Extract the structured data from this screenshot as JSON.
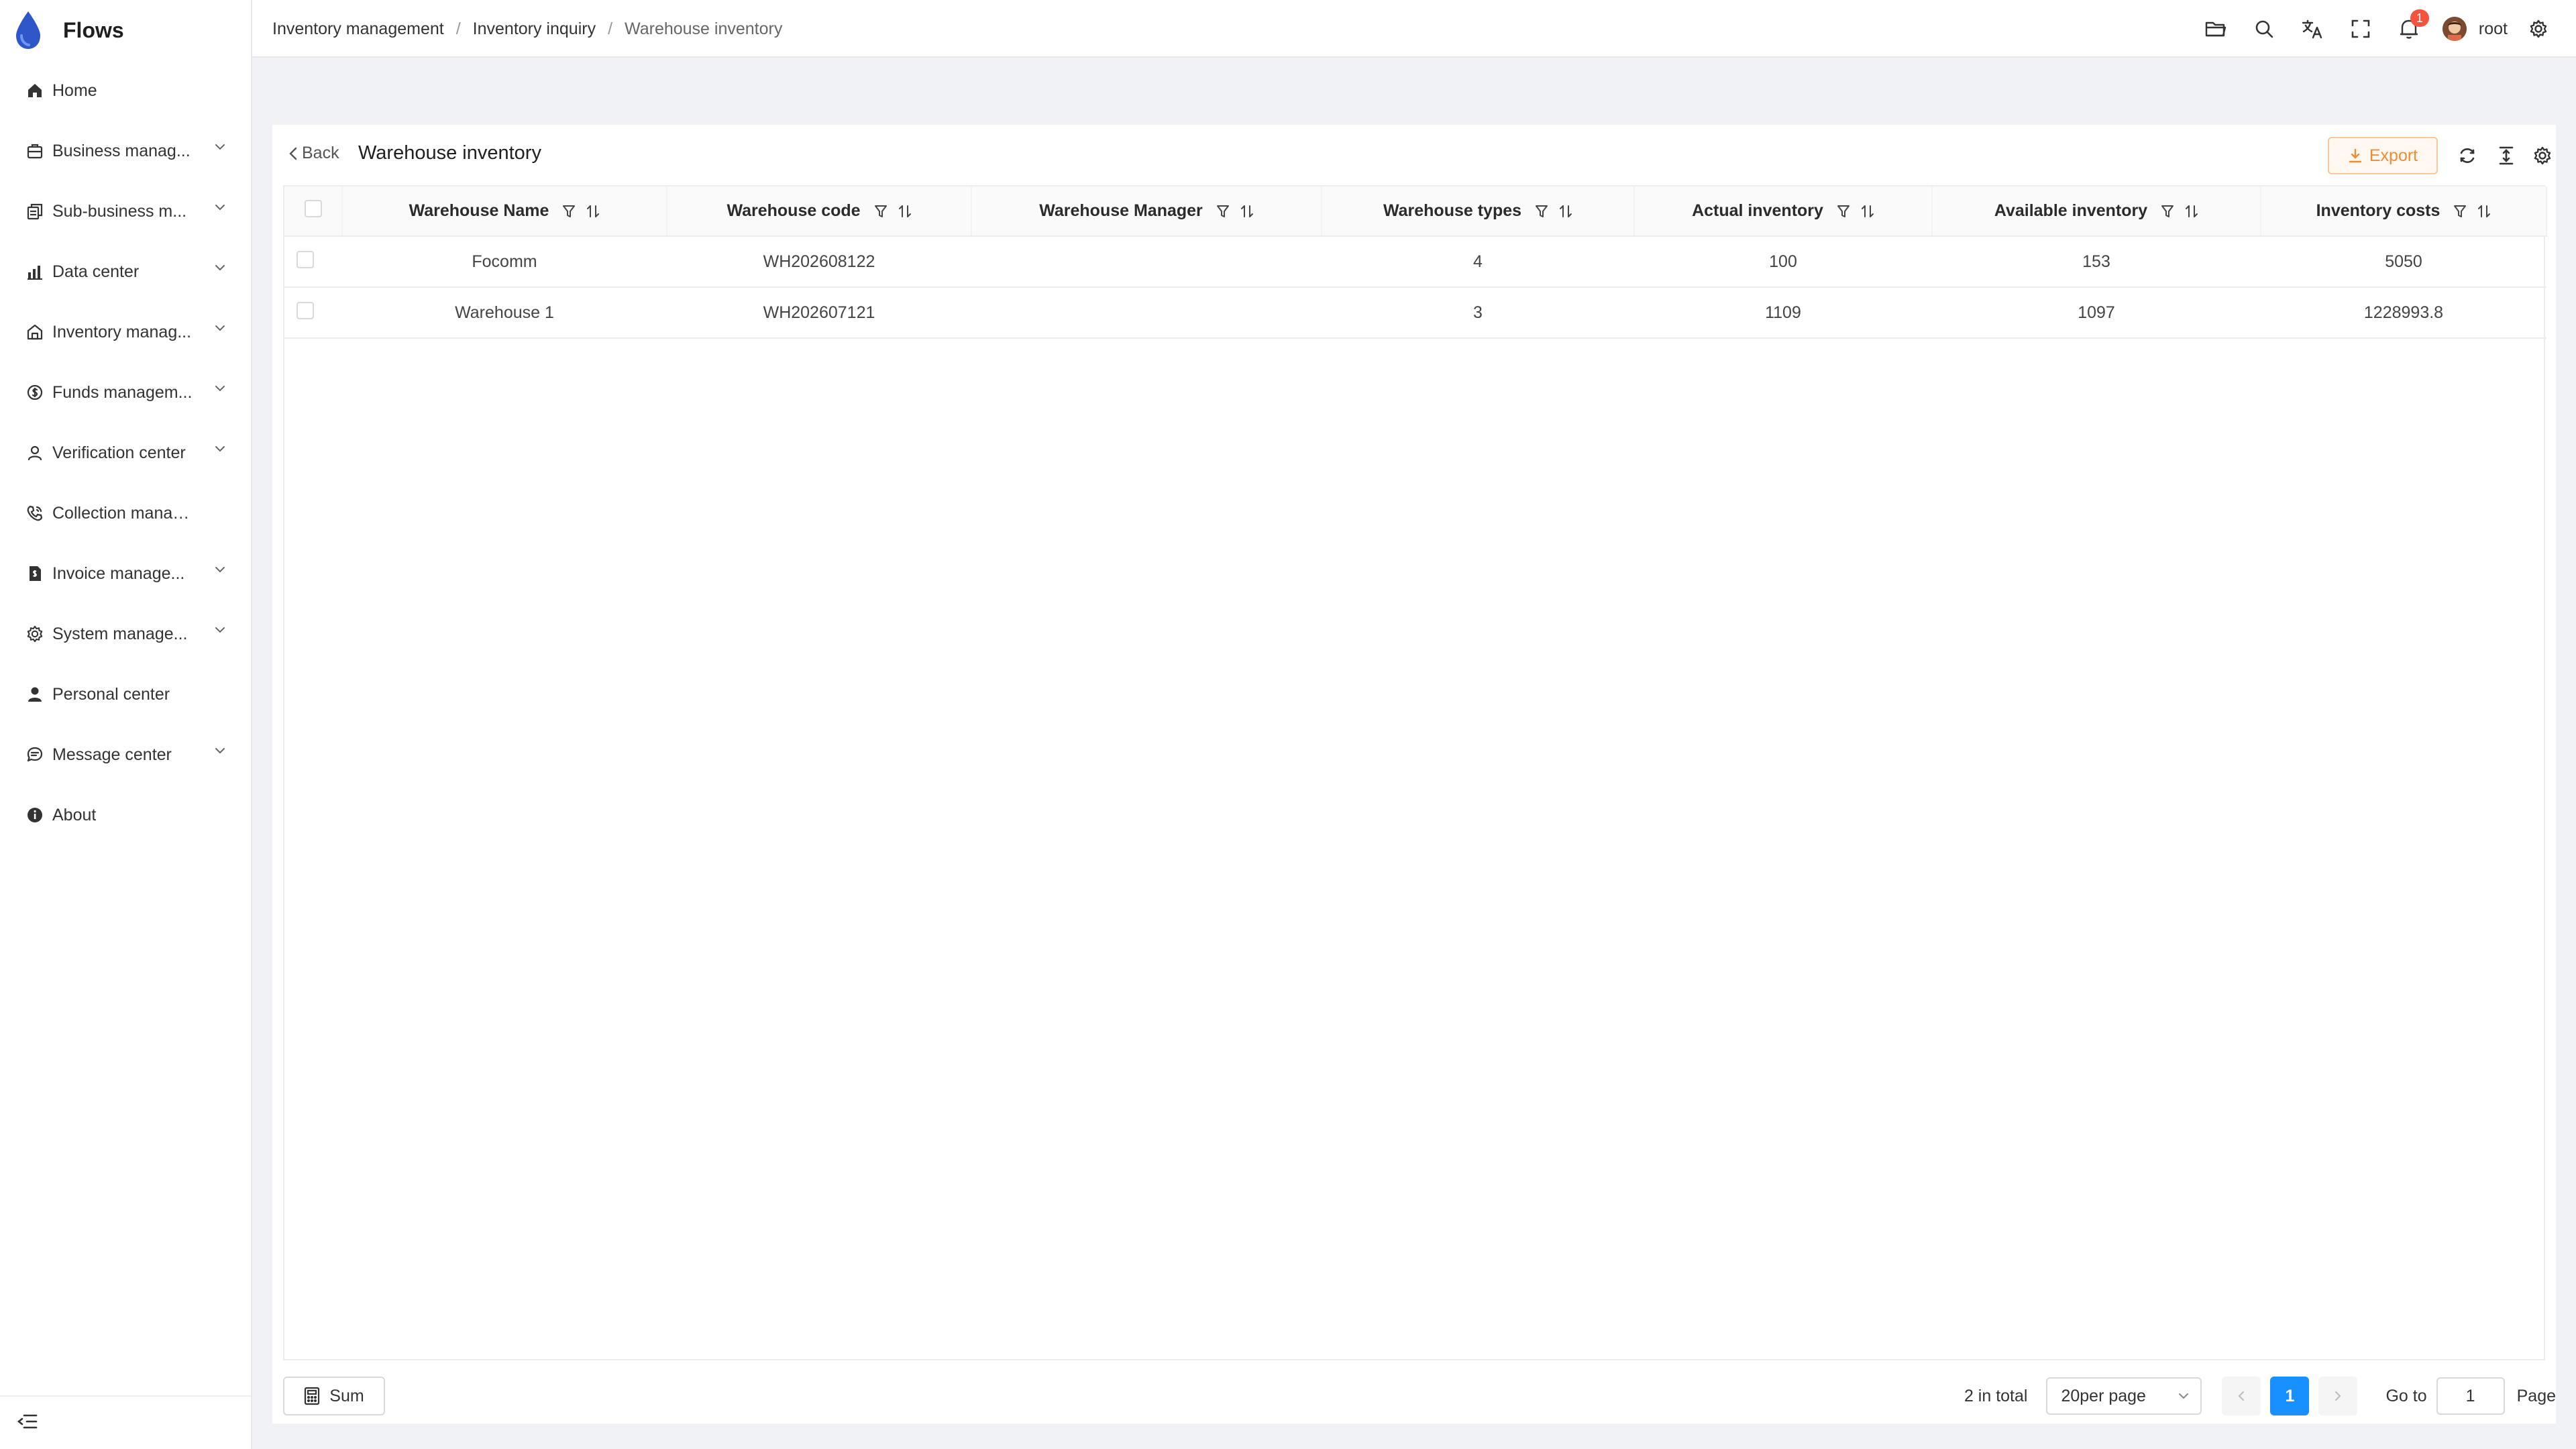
{
  "app": {
    "title": "Flows"
  },
  "sidebar": {
    "items": [
      {
        "label": "Home",
        "icon": "home-icon",
        "expandable": false
      },
      {
        "label": "Business manag...",
        "icon": "briefcase-icon",
        "expandable": true
      },
      {
        "label": "Sub-business m...",
        "icon": "copy-icon",
        "expandable": true
      },
      {
        "label": "Data center",
        "icon": "bar-chart-icon",
        "expandable": true
      },
      {
        "label": "Inventory manag...",
        "icon": "warehouse-icon",
        "expandable": true
      },
      {
        "label": "Funds managem...",
        "icon": "dollar-circle-icon",
        "expandable": true
      },
      {
        "label": "Verification center",
        "icon": "user-check-icon",
        "expandable": true
      },
      {
        "label": "Collection managem...",
        "icon": "phone-icon",
        "expandable": false
      },
      {
        "label": "Invoice manage...",
        "icon": "invoice-icon",
        "expandable": true
      },
      {
        "label": "System manage...",
        "icon": "gear-icon",
        "expandable": true
      },
      {
        "label": "Personal center",
        "icon": "person-icon",
        "expandable": false
      },
      {
        "label": "Message center",
        "icon": "chat-icon",
        "expandable": true
      },
      {
        "label": "About",
        "icon": "info-icon",
        "expandable": false
      }
    ]
  },
  "header": {
    "breadcrumb": [
      "Inventory management",
      "Inventory inquiry",
      "Warehouse inventory"
    ],
    "separator": "/",
    "notification_count": "1",
    "user_name": "root"
  },
  "page": {
    "back_label": "Back",
    "title": "Warehouse inventory",
    "export_label": "Export",
    "accent_color": "#1890ff",
    "export_color": "#f08c35"
  },
  "table": {
    "columns": [
      "Warehouse Name",
      "Warehouse code",
      "Warehouse Manager",
      "Warehouse types",
      "Actual inventory",
      "Available inventory",
      "Inventory costs"
    ],
    "rows": [
      [
        "Focomm",
        "WH202608122",
        "",
        "4",
        "100",
        "153",
        "5050"
      ],
      [
        "Warehouse 1",
        "WH202607121",
        "",
        "3",
        "1109",
        "1097",
        "1228993.8"
      ]
    ]
  },
  "footer": {
    "sum_label": "Sum",
    "total_text": "2 in total",
    "page_size": "20per page",
    "current_page": "1",
    "goto_label": "Go to",
    "goto_value": "1",
    "page_label": "Page"
  }
}
